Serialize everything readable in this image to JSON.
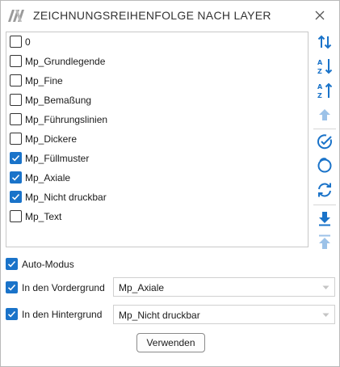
{
  "window": {
    "title": "ZEICHNUNGSREIHENFOLGE NACH LAYER",
    "logo_icon": "company-logo-icon",
    "close_icon": "close-icon"
  },
  "layers": [
    {
      "label": "0",
      "checked": false
    },
    {
      "label": "Mp_Grundlegende",
      "checked": false
    },
    {
      "label": "Mp_Fine",
      "checked": false
    },
    {
      "label": "Mp_Bemaßung",
      "checked": false
    },
    {
      "label": "Mp_Führungslinien",
      "checked": false
    },
    {
      "label": "Mp_Dickere",
      "checked": false
    },
    {
      "label": "Mp_Füllmuster",
      "checked": true
    },
    {
      "label": "Mp_Axiale",
      "checked": true
    },
    {
      "label": "Mp_Nicht druckbar",
      "checked": true
    },
    {
      "label": "Mp_Text",
      "checked": false
    }
  ],
  "toolbar": {
    "buttons": [
      "swap-order-icon",
      "sort-az-icon",
      "sort-za-icon",
      "move-up-icon",
      "check-all-icon",
      "uncheck-all-icon",
      "refresh-icon",
      "move-to-bottom-icon",
      "move-to-top-icon"
    ]
  },
  "options": {
    "auto_mode": {
      "label": "Auto-Modus",
      "checked": true
    },
    "foreground": {
      "label": "In den Vordergrund",
      "checked": true,
      "value": "Mp_Axiale"
    },
    "background": {
      "label": "In den Hintergrund",
      "checked": true,
      "value": "Mp_Nicht druckbar"
    }
  },
  "apply_button": "Verwenden",
  "colors": {
    "accent": "#1a73c9",
    "disabled_icon": "#9cc2e8"
  }
}
